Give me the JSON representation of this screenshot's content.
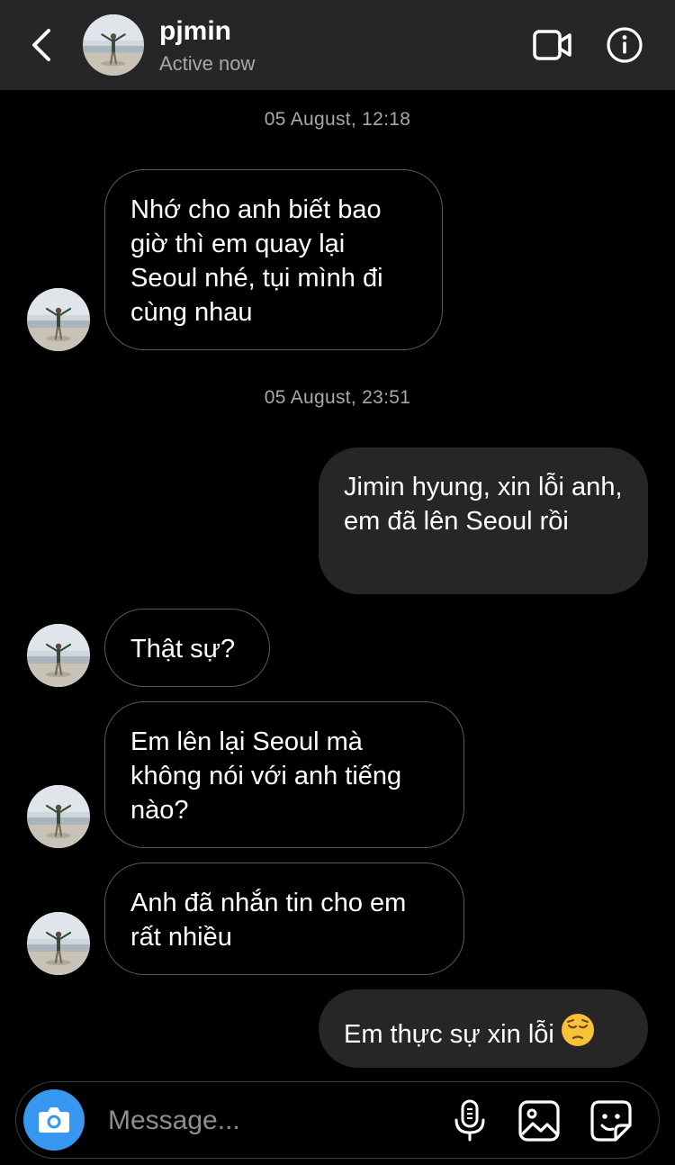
{
  "header": {
    "username": "pjmin",
    "status": "Active now",
    "back_icon": "chevron-left-icon",
    "video_icon": "video-camera-icon",
    "info_icon": "info-icon"
  },
  "colors": {
    "header_bg": "#262626",
    "outgoing_bubble": "#262626",
    "incoming_border": "#5a5a5a",
    "camera_accent": "#3797f0",
    "secondary_text": "#a8a8a8"
  },
  "messages": {
    "ts1": "05 August, 12:18",
    "m1": "Nhớ cho anh biết bao giờ thì em quay lại Seoul nhé, tụi mình đi cùng nhau",
    "ts2": "05 August, 23:51",
    "m2": "Jimin hyung, xin lỗi anh, em đã lên Seoul rồi",
    "m3": "Thật sự?",
    "m4": "Em lên lại Seoul mà không nói với anh tiếng nào?",
    "m5": "Anh đã nhắn tin cho em rất nhiều",
    "m6": "Em thực sự xin lỗi",
    "m6_emoji": "pensive-face-emoji"
  },
  "composer": {
    "placeholder": "Message...",
    "value": "",
    "camera_icon": "camera-icon",
    "mic_icon": "microphone-icon",
    "gallery_icon": "image-gallery-icon",
    "sticker_icon": "sticker-icon"
  }
}
